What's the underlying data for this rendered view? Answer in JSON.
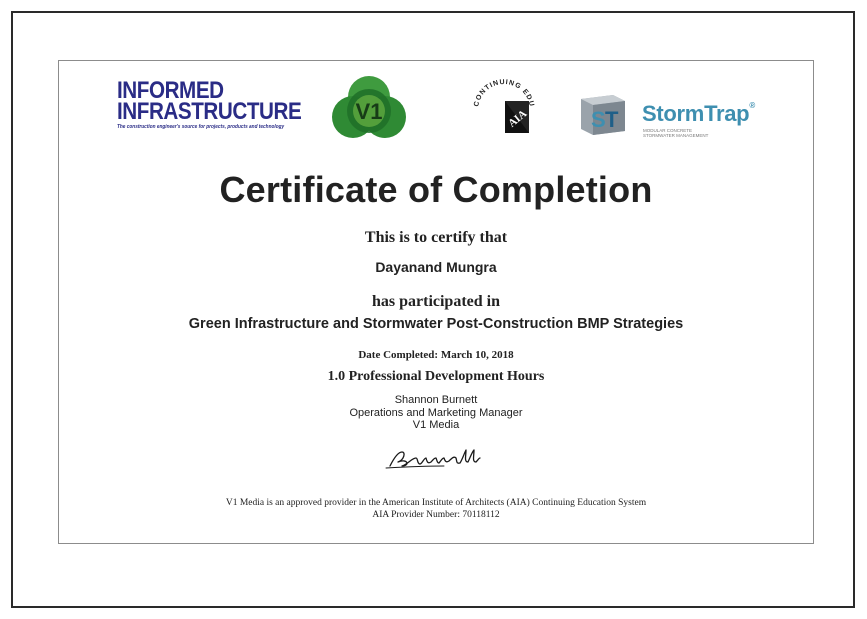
{
  "logos": {
    "informed_infrastructure": {
      "line1": "INFORMED",
      "line2": "INFRASTRUCTURE",
      "tagline": "The construction engineer's source for projects, products and technology",
      "color": "#2a2c86",
      "icon": "informed-infrastructure-logo"
    },
    "v1": {
      "text": "V1",
      "color": "#2e8b3a",
      "icon": "v1-logo"
    },
    "aia": {
      "ring_text": "CONTINUING EDUCATION",
      "mark": "AIA",
      "icon": "aia-continuing-education-logo"
    },
    "stormtrap": {
      "name_part1": "Storm",
      "name_part2": "Trap",
      "registered": "®",
      "subtitle": "MODULAR CONCRETE\nSTORMWATER MANAGEMENT",
      "color": "#3e8fb0",
      "icon": "stormtrap-logo"
    }
  },
  "certificate": {
    "title": "Certificate of Completion",
    "certify_line": "This is to certify that",
    "recipient": "Dayanand Mungra",
    "participated_line": "has participated in",
    "course": "Green Infrastructure and Stormwater Post-Construction BMP Strategies",
    "date_label": "Date Completed:",
    "date_value": "March 10, 2018",
    "hours": "1.0 Professional Development Hours",
    "signer_name": "Shannon Burnett",
    "signer_title": "Operations and Marketing Manager",
    "signer_org": "V1 Media",
    "signature_text": "SBurnett",
    "footer_line1": "V1 Media is an approved provider in the American Institute of Architects (AIA) Continuing Education System",
    "footer_line2": "AIA Provider Number: 70118112"
  }
}
